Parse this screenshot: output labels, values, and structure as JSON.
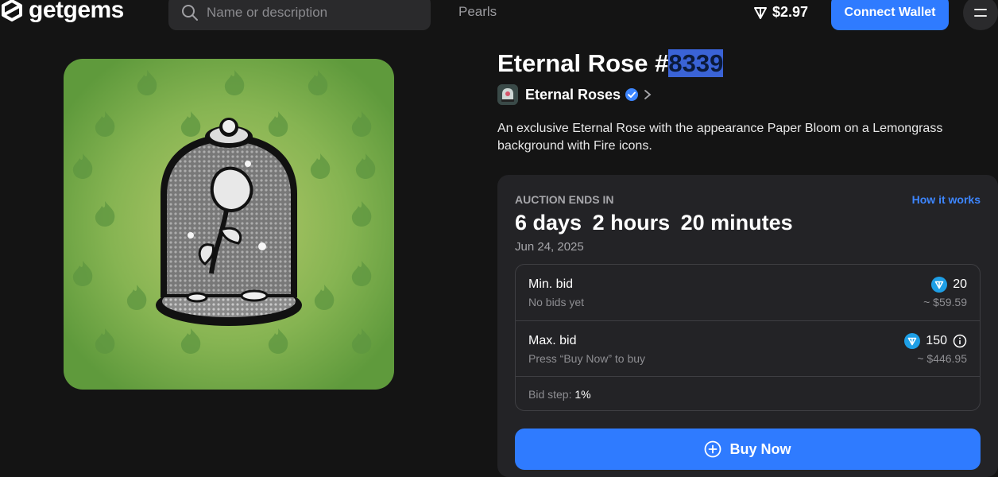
{
  "header": {
    "logo_text": "getgems",
    "search_placeholder": "Name or description",
    "nav_pearls": "Pearls",
    "balance": "$2.97",
    "connect_label": "Connect Wallet"
  },
  "nft": {
    "title_prefix": "Eternal Rose #",
    "title_number": "8339",
    "collection_name": "Eternal Roses",
    "description": "An exclusive Eternal Rose with the appearance Paper Bloom on a Lemongrass background with Fire icons."
  },
  "auction": {
    "label": "AUCTION ENDS IN",
    "how_it_works": "How it works",
    "days": "6 days",
    "hours": "2 hours",
    "minutes": "20 minutes",
    "end_date": "Jun 24, 2025",
    "min_bid": {
      "label": "Min. bid",
      "sub": "No bids yet",
      "value": "20",
      "usd": "~ $59.59"
    },
    "max_bid": {
      "label": "Max. bid",
      "sub": "Press “Buy Now” to buy",
      "value": "150",
      "usd": "~ $446.95"
    },
    "bid_step_label": "Bid step:",
    "bid_step_value": "1%",
    "buy_now": "Buy Now"
  },
  "colors": {
    "accent": "#2f7bff",
    "background": "#141414",
    "card": "#232326",
    "image_bg": "#6fa64a"
  }
}
